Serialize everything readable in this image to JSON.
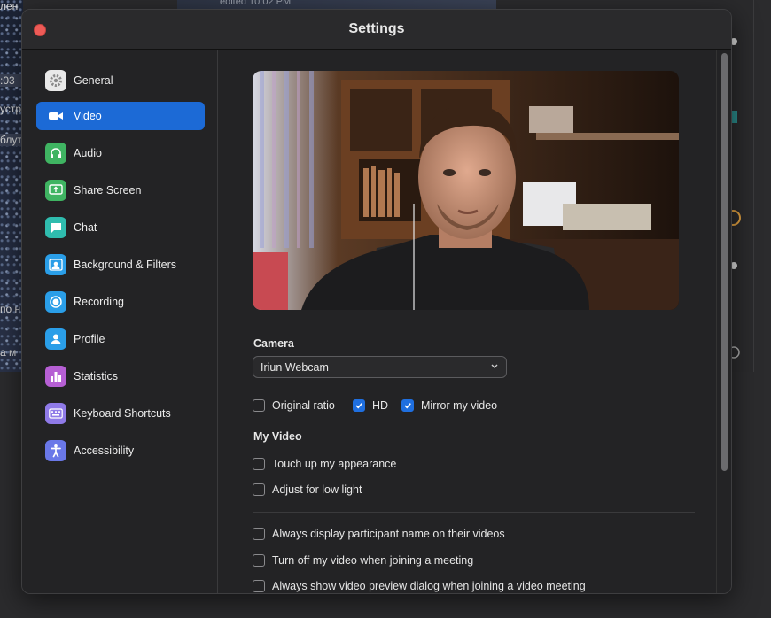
{
  "background": {
    "left_snippets": [
      "лен",
      ":03",
      "устр",
      "блут",
      "по н",
      "а м"
    ],
    "top_text": "edited 10:02 PM"
  },
  "window": {
    "title": "Settings"
  },
  "sidebar": {
    "items": [
      {
        "label": "General",
        "icon": "gear-icon",
        "color": "#e9e9e9"
      },
      {
        "label": "Video",
        "icon": "video-camera-icon",
        "color": "#1c6ad6",
        "active": true
      },
      {
        "label": "Audio",
        "icon": "headphones-icon",
        "color": "#3fb462"
      },
      {
        "label": "Share Screen",
        "icon": "share-screen-icon",
        "color": "#3fb462"
      },
      {
        "label": "Chat",
        "icon": "chat-bubble-icon",
        "color": "#2fbcae"
      },
      {
        "label": "Background & Filters",
        "icon": "background-icon",
        "color": "#2a9ee8"
      },
      {
        "label": "Recording",
        "icon": "record-icon",
        "color": "#2a9ee8"
      },
      {
        "label": "Profile",
        "icon": "profile-icon",
        "color": "#2a9ee8"
      },
      {
        "label": "Statistics",
        "icon": "statistics-icon",
        "color": "#b65fd4"
      },
      {
        "label": "Keyboard Shortcuts",
        "icon": "keyboard-icon",
        "color": "#8f7ae8"
      },
      {
        "label": "Accessibility",
        "icon": "accessibility-icon",
        "color": "#6a78e8"
      }
    ]
  },
  "video": {
    "camera_title": "Camera",
    "camera_selected": "Iriun Webcam",
    "options": [
      {
        "label": "Original ratio",
        "checked": false
      },
      {
        "label": "HD",
        "checked": true
      },
      {
        "label": "Mirror my video",
        "checked": true
      }
    ],
    "my_video_title": "My Video",
    "my_video_options": [
      {
        "label": "Touch up my appearance",
        "checked": false
      },
      {
        "label": "Adjust for low light",
        "checked": false
      }
    ],
    "more_options": [
      {
        "label": "Always display participant name on their videos",
        "checked": false
      },
      {
        "label": "Turn off my video when joining a meeting",
        "checked": false
      },
      {
        "label": "Always show video preview dialog when joining a video meeting",
        "checked": false
      }
    ]
  },
  "colors": {
    "accent": "#1c6ad6",
    "close": "#ed5b57"
  }
}
